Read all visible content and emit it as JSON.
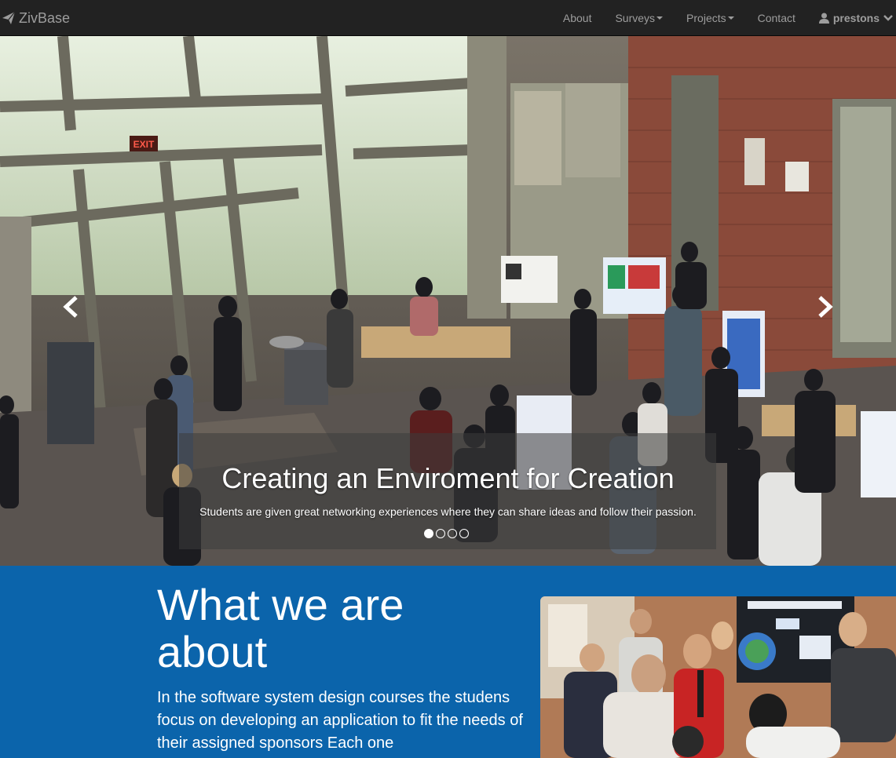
{
  "navbar": {
    "brand": "ZivBase",
    "items": [
      {
        "label": "About"
      },
      {
        "label": "Surveys"
      },
      {
        "label": "Projects"
      },
      {
        "label": "Contact"
      }
    ],
    "user": "prestons"
  },
  "carousel": {
    "title": "Creating an Enviroment for Creation",
    "text": "Students are given great networking experiences where they can share ideas and follow their passion.",
    "slide_count": 4,
    "active_slide": 1,
    "scene_sign_text": "EXIT"
  },
  "about": {
    "heading_line1": "What we are",
    "heading_line2": "about",
    "text": "In the software system design courses the studens focus on developing an application to fit the needs of their assigned sponsors Each one"
  },
  "colors": {
    "navbar_bg": "#222222",
    "nav_text": "#9d9d9d",
    "about_bg": "#0b64ab"
  }
}
